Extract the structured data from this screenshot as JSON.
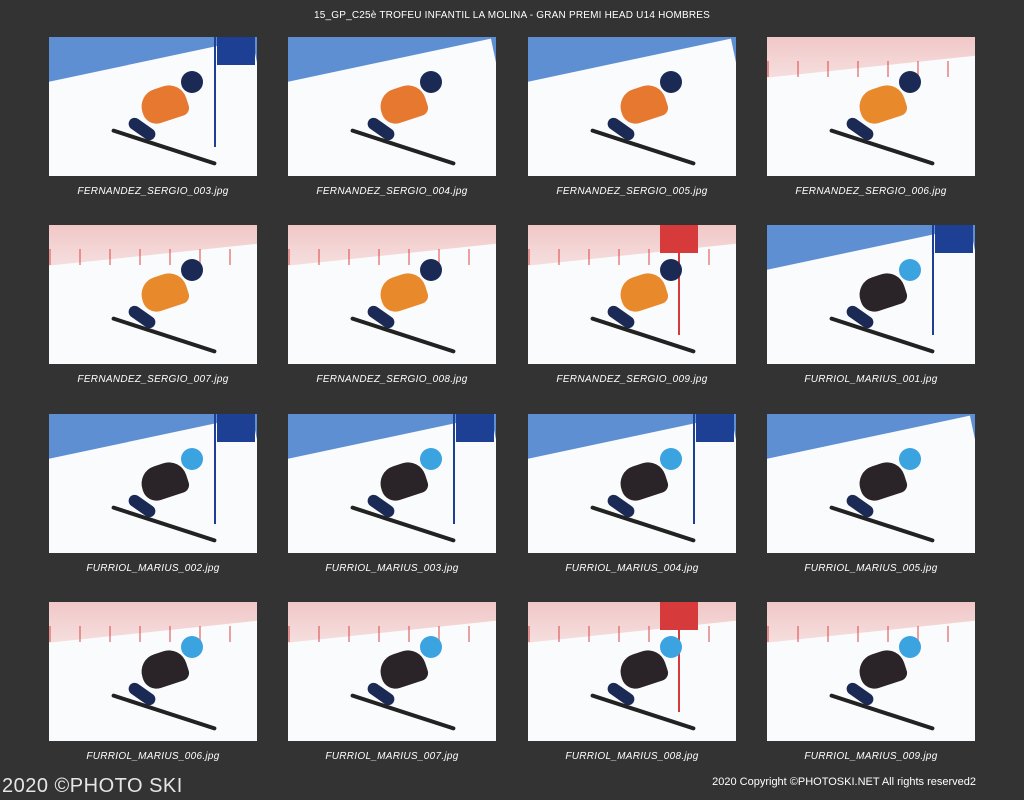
{
  "header": {
    "title": "15_GP_C25è TROFEU INFANTIL LA MOLINA - GRAN PREMI HEAD U14 HOMBRES"
  },
  "thumbnails": [
    {
      "caption": "FERNANDEZ_SERGIO_003.jpg",
      "scene": "blue-sky",
      "suit": "#e6782f",
      "helmet": "#1b2a55",
      "gate": "blue"
    },
    {
      "caption": "FERNANDEZ_SERGIO_004.jpg",
      "scene": "blue-sky",
      "suit": "#e6782f",
      "helmet": "#1b2a55",
      "gate": "none"
    },
    {
      "caption": "FERNANDEZ_SERGIO_005.jpg",
      "scene": "blue-sky",
      "suit": "#e6782f",
      "helmet": "#1b2a55",
      "gate": "none"
    },
    {
      "caption": "FERNANDEZ_SERGIO_006.jpg",
      "scene": "fence",
      "suit": "#e88a2c",
      "helmet": "#1b2a55",
      "gate": "none"
    },
    {
      "caption": "FERNANDEZ_SERGIO_007.jpg",
      "scene": "fence",
      "suit": "#e88a2c",
      "helmet": "#1b2a55",
      "gate": "none"
    },
    {
      "caption": "FERNANDEZ_SERGIO_008.jpg",
      "scene": "fence",
      "suit": "#e88a2c",
      "helmet": "#1b2a55",
      "gate": "none"
    },
    {
      "caption": "FERNANDEZ_SERGIO_009.jpg",
      "scene": "fence",
      "suit": "#e88a2c",
      "helmet": "#1b2a55",
      "gate": "red"
    },
    {
      "caption": "FURRIOL_MARIUS_001.jpg",
      "scene": "blue-sky",
      "suit": "#2a2328",
      "helmet": "#3aa3e0",
      "gate": "blue"
    },
    {
      "caption": "FURRIOL_MARIUS_002.jpg",
      "scene": "blue-sky",
      "suit": "#2a2328",
      "helmet": "#3aa3e0",
      "gate": "blue"
    },
    {
      "caption": "FURRIOL_MARIUS_003.jpg",
      "scene": "blue-sky",
      "suit": "#2a2328",
      "helmet": "#3aa3e0",
      "gate": "blue"
    },
    {
      "caption": "FURRIOL_MARIUS_004.jpg",
      "scene": "blue-sky",
      "suit": "#2a2328",
      "helmet": "#3aa3e0",
      "gate": "blue"
    },
    {
      "caption": "FURRIOL_MARIUS_005.jpg",
      "scene": "blue-sky",
      "suit": "#2a2328",
      "helmet": "#3aa3e0",
      "gate": "none"
    },
    {
      "caption": "FURRIOL_MARIUS_006.jpg",
      "scene": "fence",
      "suit": "#2a2328",
      "helmet": "#3aa3e0",
      "gate": "none"
    },
    {
      "caption": "FURRIOL_MARIUS_007.jpg",
      "scene": "fence",
      "suit": "#2a2328",
      "helmet": "#3aa3e0",
      "gate": "none"
    },
    {
      "caption": "FURRIOL_MARIUS_008.jpg",
      "scene": "fence",
      "suit": "#2a2328",
      "helmet": "#3aa3e0",
      "gate": "red"
    },
    {
      "caption": "FURRIOL_MARIUS_009.jpg",
      "scene": "fence",
      "suit": "#2a2328",
      "helmet": "#3aa3e0",
      "gate": "none"
    }
  ],
  "footer": {
    "watermark": "2020 ©PHOTO SKI",
    "copyright": "2020 Copyright ©PHOTOSKI.NET All rights reserved",
    "page_number": "2"
  },
  "colors": {
    "background": "#333333",
    "text": "#ffffff"
  }
}
